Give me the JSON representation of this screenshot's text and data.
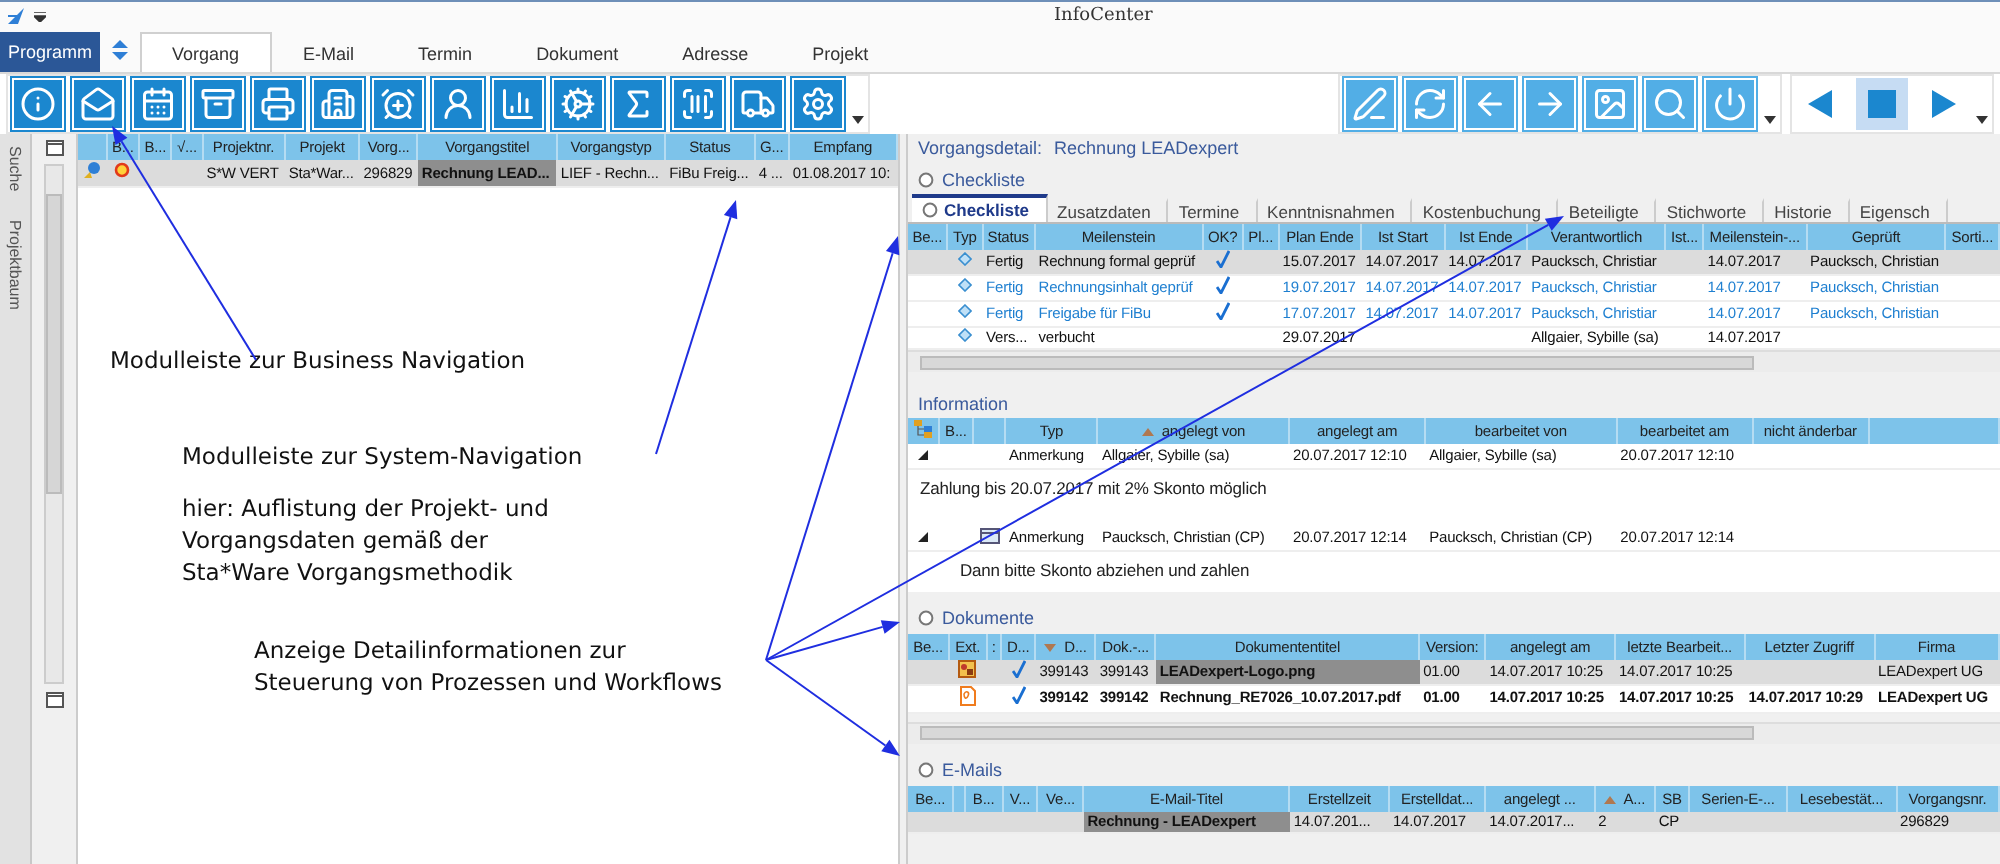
{
  "window": {
    "title": "InfoCenter"
  },
  "ribbon": {
    "program_button": "Programm",
    "tabs": [
      {
        "label": "Vorgang",
        "selected": true
      },
      {
        "label": "E-Mail",
        "selected": false
      },
      {
        "label": "Termin",
        "selected": false
      },
      {
        "label": "Dokument",
        "selected": false
      },
      {
        "label": "Adresse",
        "selected": false
      },
      {
        "label": "Projekt",
        "selected": false
      }
    ]
  },
  "media_buttons": [
    {
      "kind": "prev",
      "selected": false
    },
    {
      "kind": "stop",
      "selected": true
    },
    {
      "kind": "next",
      "selected": false
    }
  ],
  "side_tabs": [
    {
      "label": "Suche"
    },
    {
      "label": "Projektbaum"
    }
  ],
  "process_list": {
    "columns": [
      {},
      {
        "label": "B..."
      },
      {
        "label": "B..."
      },
      {
        "label": "√..."
      },
      {
        "label": "Projektnr."
      },
      {
        "label": "Projekt"
      },
      {
        "label": "Vorg..."
      },
      {
        "label": "Vorgangstitel"
      },
      {
        "label": "Vorgangstyp"
      },
      {
        "label": "Status"
      },
      {
        "label": "G..."
      },
      {
        "label": "Empfang"
      }
    ],
    "rows": [
      {
        "selected": true,
        "project_no": "S*W VERT",
        "project": "Sta*War...",
        "number": "296829",
        "title": "Rechnung LEAD...",
        "type": "LIEF - Rechn...",
        "status": "FiBu Freig...",
        "g": "4 ...",
        "received": "01.08.2017 10:"
      }
    ]
  },
  "annotations": [
    {
      "text": "Modulleiste zur Business Navigation"
    },
    {
      "text": "Modulleiste zur System-Navigation"
    },
    {
      "text": "hier: Auflistung der Projekt- und\nVorgangsdaten gemäß der\nSta*Ware Vorgangsmethodik"
    },
    {
      "text": "Anzeige Detailinformationen zur\nSteuerung von Prozessen und Workflows"
    }
  ],
  "detail": {
    "label": "Vorgangsdetail:",
    "title": "Rechnung LEADexpert"
  },
  "checklist": {
    "title": "Checkliste",
    "tabs": [
      {
        "label": "Checkliste",
        "selected": true
      },
      {
        "label": "Zusatzdaten",
        "selected": false
      },
      {
        "label": "Termine",
        "selected": false
      },
      {
        "label": "Kenntnisnahmen",
        "selected": false
      },
      {
        "label": "Kostenbuchung",
        "selected": false
      },
      {
        "label": "Beteiligte",
        "selected": false
      },
      {
        "label": "Stichworte",
        "selected": false
      },
      {
        "label": "Historie",
        "selected": false
      },
      {
        "label": "Eigensch",
        "selected": false
      }
    ],
    "columns": [
      {
        "label": "Be..."
      },
      {
        "label": "Typ"
      },
      {
        "label": "Status"
      },
      {
        "label": "Meilenstein"
      },
      {
        "label": "OK?"
      },
      {
        "label": "Pl..."
      },
      {
        "label": "Plan Ende"
      },
      {
        "label": "Ist Start"
      },
      {
        "label": "Ist Ende"
      },
      {
        "label": "Verantwortlich"
      },
      {
        "label": "Ist..."
      },
      {
        "label": "Meilenstein-..."
      },
      {
        "label": "Geprüft"
      },
      {
        "label": "Sorti..."
      }
    ],
    "rows": [
      {
        "selected": true,
        "done": true,
        "ok": true,
        "status": "Fertig",
        "milestone": "Rechnung formal geprüf",
        "plan_end": "15.07.2017",
        "ist_start": "14.07.2017",
        "ist_end": "14.07.2017",
        "responsible": "Paucksch, Christiar",
        "milestone_date": "14.07.2017",
        "checked_by": "Paucksch, Christian"
      },
      {
        "selected": false,
        "done": true,
        "ok": true,
        "status": "Fertig",
        "milestone": "Rechnungsinhalt geprüf",
        "plan_end": "19.07.2017",
        "ist_start": "14.07.2017",
        "ist_end": "14.07.2017",
        "responsible": "Paucksch, Christiar",
        "milestone_date": "14.07.2017",
        "checked_by": "Paucksch, Christian"
      },
      {
        "selected": false,
        "done": true,
        "ok": true,
        "status": "Fertig",
        "milestone": "Freigabe für FiBu",
        "plan_end": "17.07.2017",
        "ist_start": "14.07.2017",
        "ist_end": "14.07.2017",
        "responsible": "Paucksch, Christiar",
        "milestone_date": "14.07.2017",
        "checked_by": "Paucksch, Christian"
      },
      {
        "selected": false,
        "done": false,
        "ok": false,
        "status": "Vers...",
        "milestone": "verbucht",
        "plan_end": "29.07.2017",
        "responsible": "Allgaier, Sybille (sa)",
        "milestone_date": "14.07.2017"
      }
    ]
  },
  "information": {
    "title": "Information",
    "columns": [
      {},
      {
        "label": "B..."
      },
      {},
      {
        "label": "Typ"
      },
      {
        "label": "angelegt von",
        "sorted": true,
        "ascending": true
      },
      {
        "label": "angelegt am"
      },
      {
        "label": "bearbeitet von"
      },
      {
        "label": "bearbeitet am"
      },
      {
        "label": "nicht änderbar"
      }
    ],
    "entries": [
      {
        "expanded": true,
        "attachment": false,
        "type": "Anmerkung",
        "created_by": "Allgaier, Sybille (sa)",
        "created_at": "20.07.2017 12:10",
        "edited_by": "Allgaier, Sybille (sa)",
        "edited_at": "20.07.2017 12:10",
        "note": "Zahlung bis 20.07.2017 mit 2% Skonto möglich"
      },
      {
        "expanded": true,
        "attachment": true,
        "type": "Anmerkung",
        "created_by": "Paucksch, Christian (CP)",
        "created_at": "20.07.2017 12:14",
        "edited_by": "Paucksch, Christian (CP)",
        "edited_at": "20.07.2017 12:14",
        "note": "Dann bitte Skonto abziehen und zahlen"
      }
    ]
  },
  "documents": {
    "title": "Dokumente",
    "columns": [
      {
        "label": "Be..."
      },
      {
        "label": "Ext."
      },
      {
        "label": ":"
      },
      {
        "label": "D..."
      },
      {
        "label": "D...",
        "sorted": true,
        "ascending": false
      },
      {
        "label": "Dok.-..."
      },
      {
        "label": "Dokumententitel"
      },
      {
        "label": "Version:"
      },
      {
        "label": "angelegt am"
      },
      {
        "label": "letzte Bearbeit..."
      },
      {
        "label": "Letzter Zugriff"
      },
      {
        "label": "Firma"
      }
    ],
    "rows": [
      {
        "selected": true,
        "unread": false,
        "kind": "image",
        "ok": true,
        "doc_id": "399143",
        "doc_no": "399143",
        "title": "LEADexpert-Logo.png",
        "version": "01.00",
        "created": "14.07.2017 10:25",
        "edited": "14.07.2017 10:25",
        "company": "LEADexpert UG"
      },
      {
        "selected": false,
        "unread": true,
        "kind": "pdf",
        "ok": true,
        "doc_id": "399142",
        "doc_no": "399142",
        "title": "Rechnung_RE7026_10.07.2017.pdf",
        "version": "01.00",
        "created": "14.07.2017 10:25",
        "edited": "14.07.2017 10:25",
        "accessed": "14.07.2017 10:29",
        "company": "LEADexpert UG"
      }
    ]
  },
  "emails": {
    "title": "E-Mails",
    "columns": [
      {
        "label": "Be..."
      },
      {},
      {
        "label": "B..."
      },
      {
        "label": "V..."
      },
      {
        "label": "Ve..."
      },
      {
        "label": "E-Mail-Titel"
      },
      {
        "label": "Erstellzeit"
      },
      {
        "label": "Erstelldat..."
      },
      {
        "label": "angelegt ..."
      },
      {
        "label": "A...",
        "sorted": true,
        "ascending": true
      },
      {
        "label": "SB"
      },
      {
        "label": "Serien-E-..."
      },
      {
        "label": "Lesebestät..."
      },
      {
        "label": "Vorgangsnr."
      }
    ],
    "rows": [
      {
        "selected": true,
        "title": "Rechnung - LEADexpert",
        "time": "14.07.201...",
        "date": "14.07.2017",
        "created": "14.07.2017...",
        "a": "2",
        "sb": "CP",
        "number": "296829"
      }
    ]
  }
}
